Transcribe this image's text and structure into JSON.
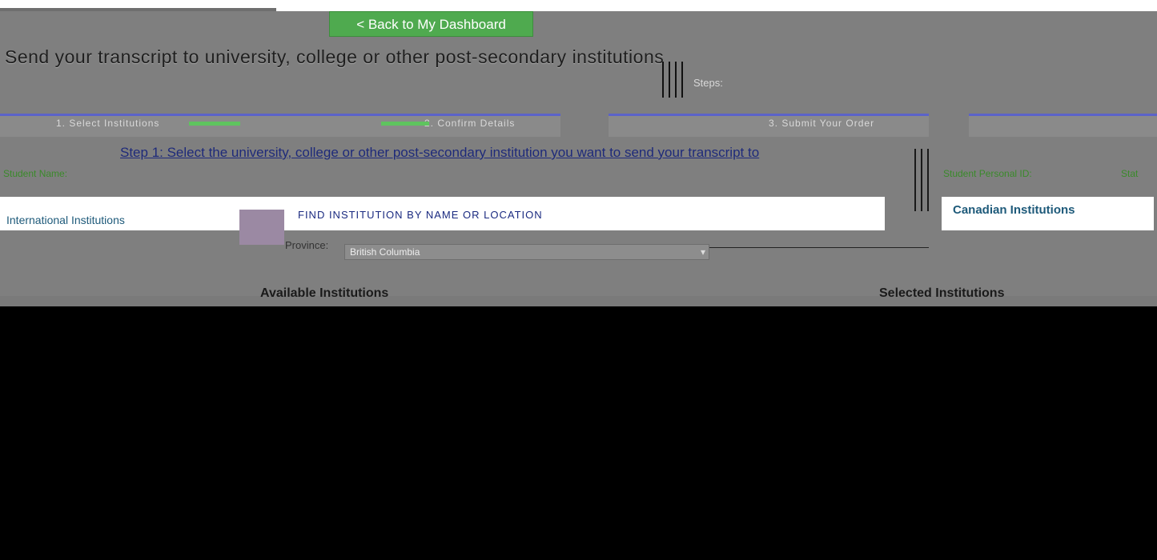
{
  "nav": {
    "back_label": "< Back to My Dashboard"
  },
  "page": {
    "title": "Send your transcript to university, college or other post-secondary institutions",
    "steps_label": "Steps:"
  },
  "steps": [
    {
      "label": "1. Select Institutions"
    },
    {
      "label": "2. Confirm Details"
    },
    {
      "label": "3. Submit Your Order"
    },
    {
      "label": ""
    }
  ],
  "instruction": "Step 1: Select the university, college or other post-secondary institution you want to send your transcript to",
  "student": {
    "name_label": "Student Name:",
    "pen_label": "Student Personal ID:",
    "extra_label": "Stat"
  },
  "tabs": {
    "international": "International Institutions",
    "canadian": "Canadian Institutions"
  },
  "search": {
    "text": "FIND INSTITUTION BY NAME OR LOCATION"
  },
  "province": {
    "label": "Province:",
    "value": "British Columbia"
  },
  "lists": {
    "available": "Available Institutions",
    "selected": "Selected Institutions"
  },
  "colors": {
    "accent_green": "#4faa4f",
    "step_blue": "#5b63c9",
    "link_blue": "#1e2a7a"
  }
}
